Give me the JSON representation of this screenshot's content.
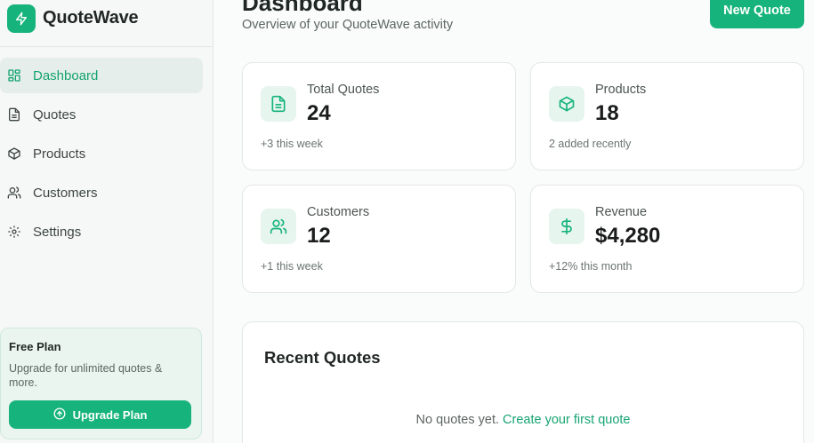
{
  "app": {
    "name": "QuoteWave"
  },
  "sidebar": {
    "items": [
      {
        "label": "Dashboard",
        "icon": "dashboard-icon",
        "active": true
      },
      {
        "label": "Quotes",
        "icon": "file-text-icon"
      },
      {
        "label": "Products",
        "icon": "box-icon"
      },
      {
        "label": "Customers",
        "icon": "users-icon"
      },
      {
        "label": "Settings",
        "icon": "gear-icon"
      }
    ],
    "plan": {
      "title": "Free Plan",
      "description": "Upgrade for unlimited quotes & more.",
      "button": "Upgrade Plan"
    }
  },
  "header": {
    "title": "Dashboard",
    "subtitle": "Overview of your QuoteWave activity",
    "new_quote": "New Quote"
  },
  "stats": [
    {
      "label": "Total Quotes",
      "value": "24",
      "note": "+3 this week",
      "icon": "file-text-icon"
    },
    {
      "label": "Products",
      "value": "18",
      "note": "2 added recently",
      "icon": "box-icon"
    },
    {
      "label": "Customers",
      "value": "12",
      "note": "+1 this week",
      "icon": "users-icon"
    },
    {
      "label": "Revenue",
      "value": "$4,280",
      "note": "+12% this month",
      "icon": "dollar-icon"
    }
  ],
  "recent": {
    "title": "Recent Quotes",
    "empty_text": "No quotes yet.",
    "empty_link": "Create your first quote"
  },
  "colors": {
    "accent": "#16b47c",
    "accent_soft": "#e6f5ee",
    "active_bg": "#e6eeeb"
  }
}
